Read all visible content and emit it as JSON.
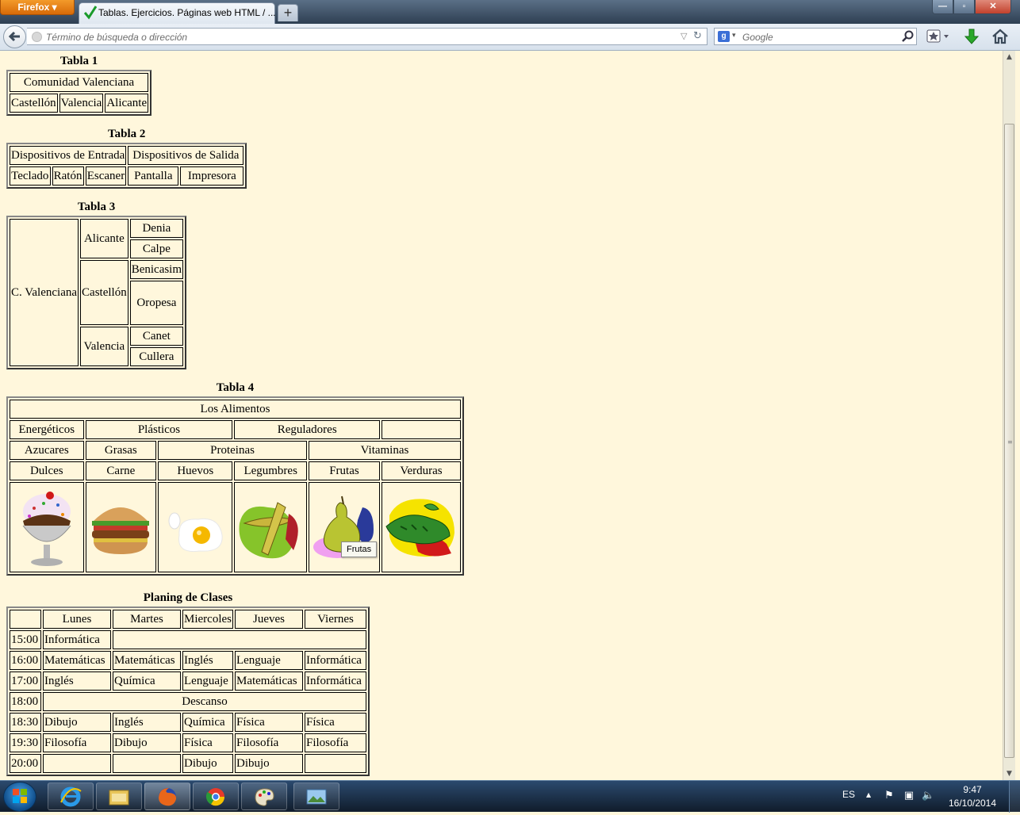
{
  "browser": {
    "app_button": "Firefox",
    "tab_title": "Tablas. Ejercicios. Páginas web HTML / ...",
    "new_tab": "+",
    "url_placeholder": "Término de búsqueda o dirección",
    "search_engine_letter": "g",
    "search_placeholder": "Google"
  },
  "tabla1": {
    "title": "Tabla 1",
    "header": "Comunidad Valenciana",
    "cells": [
      "Castellón",
      "Valencia",
      "Alicante"
    ]
  },
  "tabla2": {
    "title": "Tabla 2",
    "headers": [
      "Dispositivos de Entrada",
      "Dispositivos de Salida"
    ],
    "cells": [
      "Teclado",
      "Ratón",
      "Escaner",
      "Pantalla",
      "Impresora"
    ]
  },
  "tabla3": {
    "title": "Tabla 3",
    "region": "C. Valenciana",
    "provinces": [
      {
        "name": "Alicante",
        "towns": [
          "Denia",
          "Calpe"
        ]
      },
      {
        "name": "Castellón",
        "towns": [
          "Benicasim",
          "Oropesa"
        ]
      },
      {
        "name": "Valencia",
        "towns": [
          "Canet",
          "Cullera"
        ]
      }
    ]
  },
  "tabla4": {
    "title": "Tabla 4",
    "header": "Los Alimentos",
    "row1": [
      "Energéticos",
      "Plásticos",
      "Reguladores",
      ""
    ],
    "row2": [
      "Azucares",
      "Grasas",
      "Proteinas",
      "Vitaminas"
    ],
    "row3": [
      "Dulces",
      "Carne",
      "Huevos",
      "Legumbres",
      "Frutas",
      "Verduras"
    ],
    "images": [
      "ice-cream",
      "hamburger",
      "fried-egg",
      "legumes",
      "fruits",
      "vegetables"
    ],
    "tooltip": "Frutas"
  },
  "planing": {
    "title": "Planing de Clases",
    "days": [
      "",
      "Lunes",
      "Martes",
      "Miercoles",
      "Jueves",
      "Viernes"
    ],
    "rows": [
      [
        "15:00",
        "Informática",
        ""
      ],
      [
        "16:00",
        "Matemáticas",
        "Matemáticas",
        "Inglés",
        "Lenguaje",
        "Informática"
      ],
      [
        "17:00",
        "Inglés",
        "Química",
        "Lenguaje",
        "Matemáticas",
        "Informática"
      ],
      [
        "18:00",
        "Descanso"
      ],
      [
        "18:30",
        "Dibujo",
        "Inglés",
        "Química",
        "Física",
        "Física"
      ],
      [
        "19:30",
        "Filosofía",
        "Dibujo",
        "Física",
        "Filosofía",
        "Filosofía"
      ],
      [
        "20:00",
        "",
        "",
        "Dibujo",
        "Dibujo",
        ""
      ]
    ]
  },
  "taskbar": {
    "language": "ES",
    "time": "9:47",
    "date": "16/10/2014",
    "apps": [
      "internet-explorer-icon",
      "file-explorer-icon",
      "firefox-icon",
      "chrome-icon",
      "paint-icon",
      "photo-viewer-icon"
    ]
  }
}
